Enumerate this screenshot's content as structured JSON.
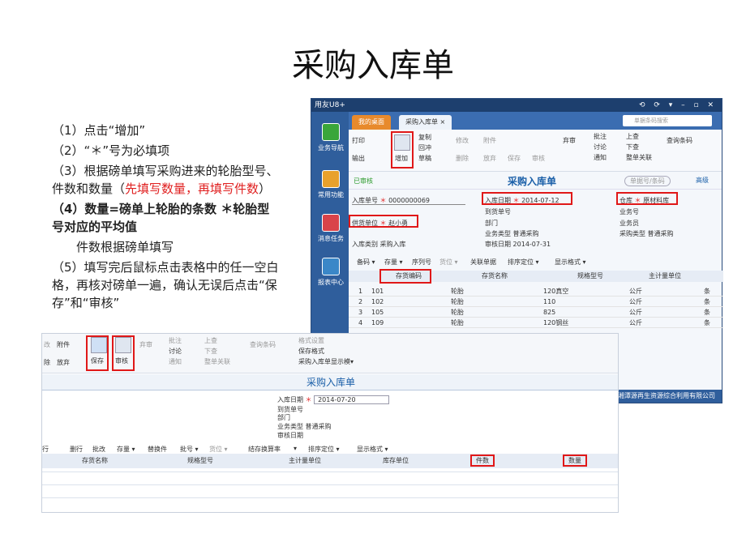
{
  "page": {
    "title": "采购入库单"
  },
  "instructions": [
    "（1）点击“增加”",
    "（2）“＊”号为必填项",
    "（3）根据磅单填写采购进来的轮胎型号、件数和数量（",
    "先填写数量，再填写件数",
    "）",
    "（4）数量=磅单上轮胎的条数 ＊轮胎型号对应的平均值",
    "件数根据磅单填写",
    "（5）填写完后鼠标点击表格中的任一空白格，再核对磅单一遍，确认无误后点击“保存”和“审核”"
  ],
  "window1": {
    "app_title": "用友U8+",
    "window_controls": "⟲ ⟳ ▾ – ▫ ✕",
    "sidebar": [
      {
        "label": "业务导航",
        "icon": "navigation-icon",
        "color": "#3aa63a"
      },
      {
        "label": "常用功能",
        "icon": "star-icon",
        "color": "#e8a12c"
      },
      {
        "label": "消息任务",
        "icon": "message-icon",
        "color": "#d9434a"
      },
      {
        "label": "报表中心",
        "icon": "report-icon",
        "color": "#3a87c8"
      }
    ],
    "tabs": [
      "我的桌面",
      "采购入库单 ×"
    ],
    "search_placeholder": "单据条码搜索",
    "toolbar": {
      "print": "打印",
      "output": "输出",
      "add": "增加",
      "copy": "复制",
      "draft": "草稿",
      "modify": "修改",
      "delete": "删除",
      "attach": "附件",
      "abandon": "放弃",
      "save": "保存",
      "review": "审核",
      "discard": "弃审",
      "annotate": "批注",
      "discuss": "讨论",
      "notify": "通知",
      "prev_page": "上查",
      "next_page": "下查",
      "whole_link": "整单关联",
      "query_barcode": "查询条码",
      "draft_restore": "回冲"
    },
    "status": "已审核",
    "form_title": "采购入库单",
    "form_search": "单据号/条码",
    "advanced": "高级",
    "fields": {
      "doc_no_label": "入库单号",
      "doc_no": "0000000069",
      "date_label": "入库日期",
      "date": "2014-07-12",
      "warehouse_label": "仓库",
      "warehouse": "原材料库",
      "arrival_label": "到货单号",
      "biz_no_label": "业务号",
      "supplier_label": "供货单位",
      "supplier": "赵小勇",
      "dept_label": "部门",
      "salesman_label": "业务员",
      "biz_type_label": "业务类型",
      "biz_type": "普通采购",
      "purchase_type_label": "采购类型",
      "purchase_type": "普通采购",
      "in_type_label": "入库类别",
      "in_type": "采购入库",
      "review_date_label": "审核日期",
      "review_date": "2014-07-31"
    },
    "grid_toolbar": [
      "备码 ▾",
      "存量 ▾",
      "序列号",
      "货位 ▾",
      "关联单据",
      "排序定位 ▾",
      "显示格式 ▾"
    ],
    "grid_headers": [
      "存货编码",
      "存货名称",
      "规格型号",
      "主计量单位"
    ],
    "rows": [
      {
        "n": "1",
        "code": "101",
        "name": "轮胎",
        "spec": "120真空",
        "unit": "公斤",
        "u2": "条"
      },
      {
        "n": "2",
        "code": "102",
        "name": "轮胎",
        "spec": "110",
        "unit": "公斤",
        "u2": "条"
      },
      {
        "n": "3",
        "code": "105",
        "name": "轮胎",
        "spec": "825",
        "unit": "公斤",
        "u2": "条"
      },
      {
        "n": "4",
        "code": "109",
        "name": "轮胎",
        "spec": "120钢丝",
        "unit": "公斤",
        "u2": "条"
      }
    ],
    "footer": "湘潭源再生资源综合利用有限公司"
  },
  "window2": {
    "toolbar": {
      "modify": "改",
      "attach": "附件",
      "abandon": "放弃",
      "delete": "除",
      "save": "保存",
      "review": "审核",
      "discard": "弃审",
      "annotate": "批注",
      "discuss": "讨论",
      "notify": "通知",
      "prev": "上查",
      "next": "下查",
      "whole": "整单关联",
      "barcode": "查询条码",
      "format_setting": "格式设置",
      "save_format": "保存格式",
      "display_template": "采购入库单显示模▾"
    },
    "form_title": "采购入库单",
    "fields": {
      "date_label": "入库日期",
      "date": "2014-07-20",
      "arrival_label": "到货单号",
      "dept_label": "部门",
      "biz_type_label": "业务类型",
      "biz_type": "普通采购",
      "review_label": "审核日期"
    },
    "grid_toolbar": [
      "行",
      "删行",
      "批改",
      "存量 ▾",
      "替换件",
      "批号 ▾",
      "货位 ▾",
      "结存换算率",
      "▾",
      "排序定位 ▾",
      "显示格式 ▾"
    ],
    "columns": [
      "存货名称",
      "规格型号",
      "主计量单位",
      "库存单位",
      "件数",
      "数量"
    ]
  }
}
